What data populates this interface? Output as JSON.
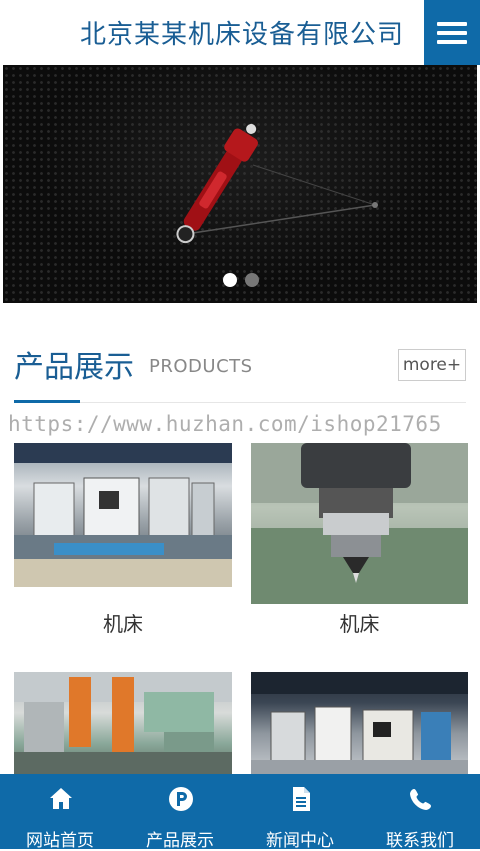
{
  "header": {
    "title": "北京某某机床设备有限公司",
    "menu_icon": "hamburger-menu-icon"
  },
  "banner": {
    "slide_count": 2,
    "active_slide": 1
  },
  "products_section": {
    "title": "产品展示",
    "subtitle": "PRODUCTS",
    "more_label": "more+",
    "items": [
      {
        "caption": "机床"
      },
      {
        "caption": "机床"
      },
      {
        "caption": ""
      },
      {
        "caption": ""
      }
    ]
  },
  "watermark": "https://www.huzhan.com/ishop21765",
  "footer_nav": [
    {
      "label": "网站首页",
      "icon": "home-icon"
    },
    {
      "label": "产品展示",
      "icon": "product-circle-p-icon"
    },
    {
      "label": "新闻中心",
      "icon": "document-icon"
    },
    {
      "label": "联系我们",
      "icon": "phone-icon"
    }
  ],
  "colors": {
    "brand_blue": "#0f6aa8",
    "title_blue": "#1a5e94"
  }
}
